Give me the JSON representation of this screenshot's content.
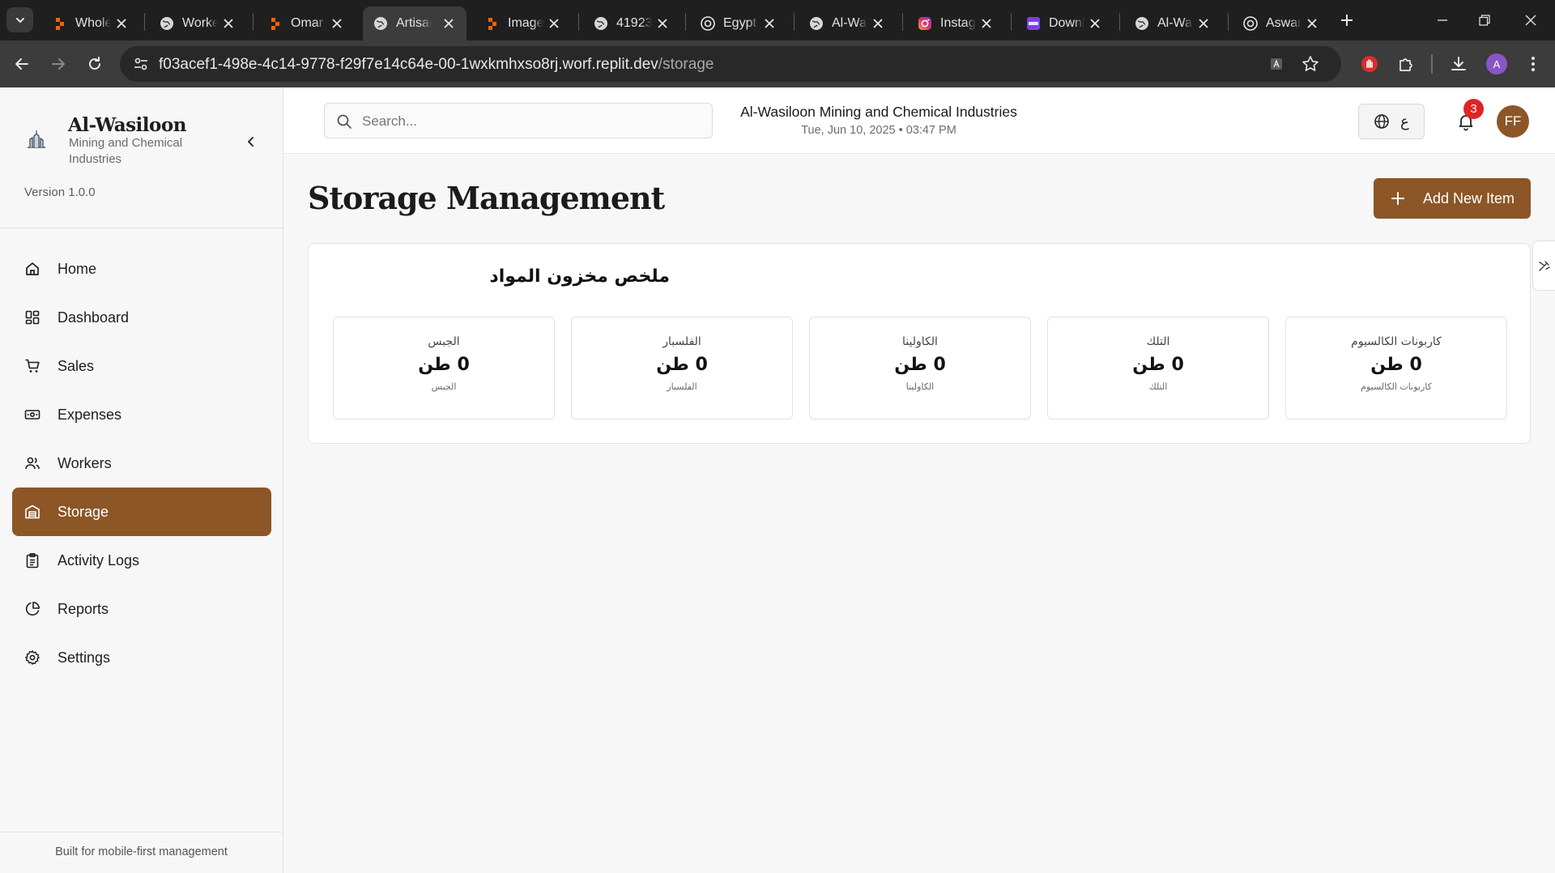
{
  "browser": {
    "tabs": [
      {
        "title": "Whole",
        "icon": "replit-icon",
        "active": false
      },
      {
        "title": "Worke",
        "icon": "globe-icon",
        "active": false
      },
      {
        "title": "Omar a",
        "icon": "replit-icon",
        "active": false
      },
      {
        "title": "Artisan",
        "icon": "globe-icon",
        "active": true
      },
      {
        "title": "ImageI",
        "icon": "replit-icon",
        "active": false
      },
      {
        "title": "41923",
        "icon": "globe-icon",
        "active": false
      },
      {
        "title": "Egypt",
        "icon": "openai-icon",
        "active": false
      },
      {
        "title": "Al-Was",
        "icon": "globe-icon",
        "active": false
      },
      {
        "title": "Instag",
        "icon": "instagram-icon",
        "active": false
      },
      {
        "title": "Downl",
        "icon": "sss-icon",
        "active": false
      },
      {
        "title": "Al-Wa",
        "icon": "globe-icon",
        "active": false
      },
      {
        "title": "Aswan",
        "icon": "openai-icon",
        "active": false
      }
    ],
    "url_host": "f03acef1-498e-4c14-9778-f29f7e14c64e-00-1wxkmhxso8rj.worf.replit.dev",
    "url_path": "/storage",
    "profile_initial": "A"
  },
  "sidebar": {
    "brand_name": "Al-Wasiloon",
    "brand_subtitle": "Mining and Chemical Industries",
    "version": "Version 1.0.0",
    "items": [
      {
        "label": "Home",
        "icon": "home-icon",
        "active": false
      },
      {
        "label": "Dashboard",
        "icon": "dashboard-icon",
        "active": false
      },
      {
        "label": "Sales",
        "icon": "cart-icon",
        "active": false
      },
      {
        "label": "Expenses",
        "icon": "banknote-icon",
        "active": false
      },
      {
        "label": "Workers",
        "icon": "users-icon",
        "active": false
      },
      {
        "label": "Storage",
        "icon": "warehouse-icon",
        "active": true
      },
      {
        "label": "Activity Logs",
        "icon": "clipboard-icon",
        "active": false
      },
      {
        "label": "Reports",
        "icon": "pie-chart-icon",
        "active": false
      },
      {
        "label": "Settings",
        "icon": "gear-icon",
        "active": false
      }
    ],
    "footer": "Built for mobile-first management"
  },
  "header": {
    "search_placeholder": "Search...",
    "company": "Al-Wasiloon Mining and Chemical Industries",
    "datetime": "Tue, Jun 10, 2025 • 03:47 PM",
    "lang_letter": "ع",
    "notification_count": "3",
    "avatar_initials": "FF"
  },
  "page": {
    "title": "Storage Management",
    "add_button": "Add New Item"
  },
  "summary": {
    "title": "ملخص مخزون المواد",
    "items": [
      {
        "name": "كاربونات الكالسيوم",
        "value": "0 طن",
        "sub": "كاربونات الكالسيوم"
      },
      {
        "name": "التلك",
        "value": "0 طن",
        "sub": "التلك"
      },
      {
        "name": "الكاولينا",
        "value": "0 طن",
        "sub": "الكاولينا"
      },
      {
        "name": "الفلسبار",
        "value": "0 طن",
        "sub": "الفلسبار"
      },
      {
        "name": "الجبس",
        "value": "0 طن",
        "sub": "الجبس"
      }
    ]
  },
  "colors": {
    "accent": "#8c5626",
    "badge": "#e02424"
  }
}
